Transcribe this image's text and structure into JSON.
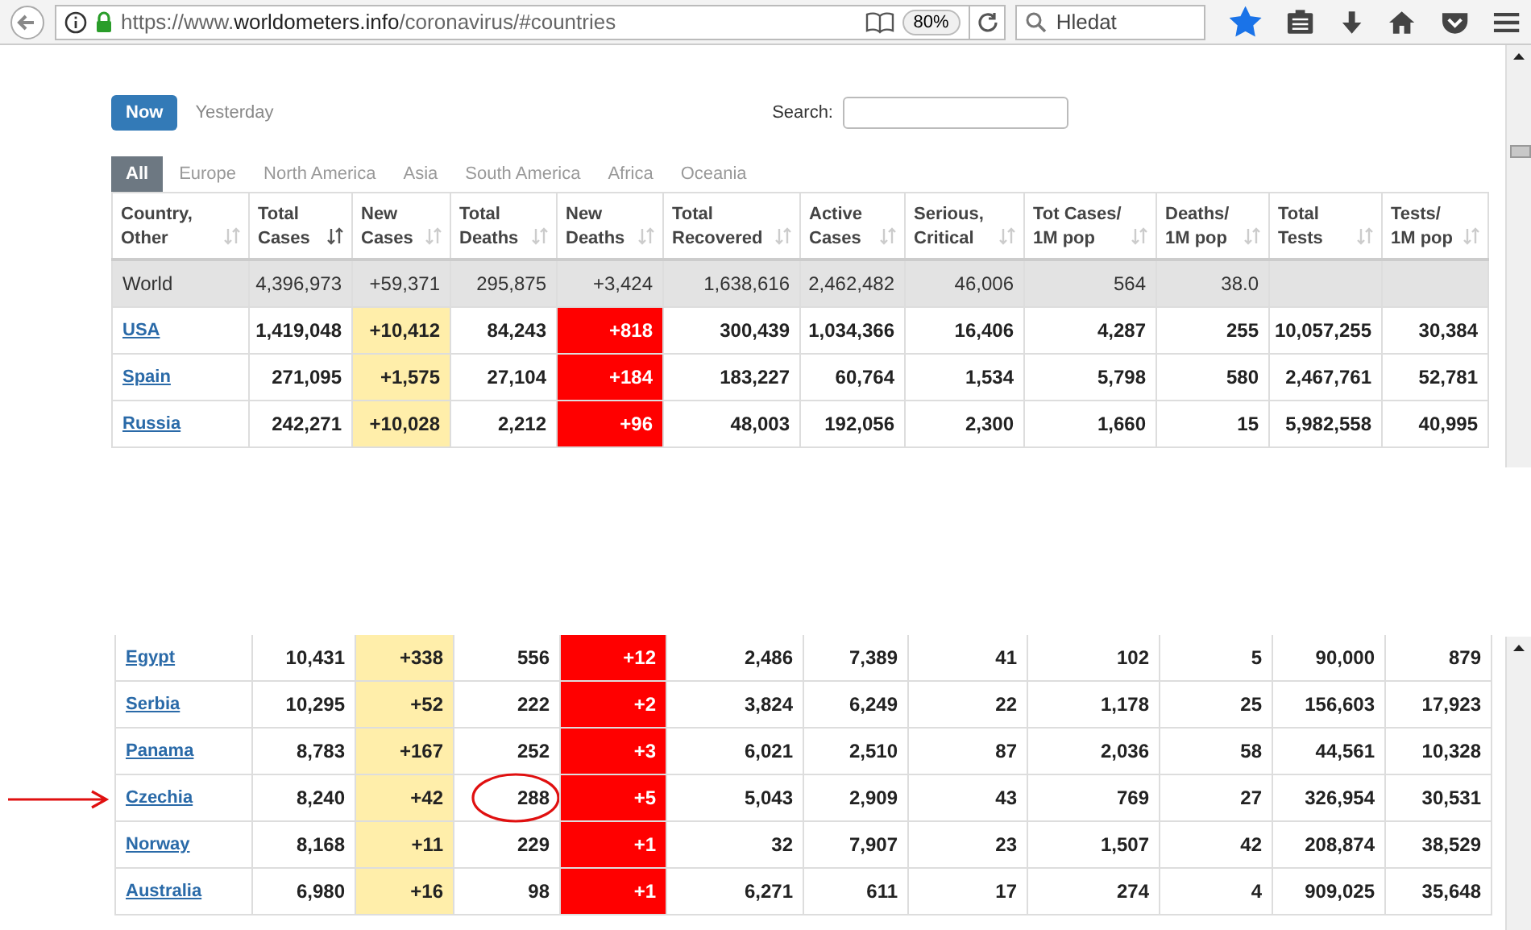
{
  "browser": {
    "url": {
      "scheme": "https://www.",
      "host": "worldometers.info",
      "path": "/coronavirus/#countries"
    },
    "zoom": "80%",
    "search": {
      "placeholder": "Hledat"
    },
    "bookmarked": true
  },
  "view_buttons": [
    {
      "label": "Now",
      "selected": true
    },
    {
      "label": "Yesterday",
      "selected": false
    }
  ],
  "search": {
    "label": "Search:"
  },
  "region_tabs": [
    {
      "label": "All",
      "selected": true
    },
    {
      "label": "Europe",
      "selected": false
    },
    {
      "label": "North America",
      "selected": false
    },
    {
      "label": "Asia",
      "selected": false
    },
    {
      "label": "South America",
      "selected": false
    },
    {
      "label": "Africa",
      "selected": false
    },
    {
      "label": "Oceania",
      "selected": false
    }
  ],
  "columns": [
    {
      "lines": [
        "Country,",
        "Other"
      ],
      "kind": "name",
      "sorted": false
    },
    {
      "lines": [
        "Total",
        "Cases"
      ],
      "kind": "number",
      "sorted": true
    },
    {
      "lines": [
        "New",
        "Cases"
      ],
      "kind": "new_cases",
      "sorted": false
    },
    {
      "lines": [
        "Total",
        "Deaths"
      ],
      "kind": "number",
      "sorted": false
    },
    {
      "lines": [
        "New",
        "Deaths"
      ],
      "kind": "new_deaths",
      "sorted": false
    },
    {
      "lines": [
        "Total",
        "Recovered"
      ],
      "kind": "number",
      "sorted": false
    },
    {
      "lines": [
        "Active",
        "Cases"
      ],
      "kind": "number",
      "sorted": false
    },
    {
      "lines": [
        "Serious,",
        "Critical"
      ],
      "kind": "number",
      "sorted": false
    },
    {
      "lines": [
        "Tot Cases/",
        "1M pop"
      ],
      "kind": "number",
      "sorted": false
    },
    {
      "lines": [
        "Deaths/",
        "1M pop"
      ],
      "kind": "number",
      "sorted": false
    },
    {
      "lines": [
        "Total",
        "Tests"
      ],
      "kind": "number",
      "sorted": false
    },
    {
      "lines": [
        "Tests/",
        "1M pop"
      ],
      "kind": "number",
      "sorted": false
    }
  ],
  "top_rows": [
    {
      "kind": "total",
      "country": "World",
      "total_cases": "4,396,973",
      "new_cases": "+59,371",
      "total_deaths": "295,875",
      "new_deaths": "+3,424",
      "total_recovered": "1,638,616",
      "active_cases": "2,462,482",
      "serious_critical": "46,006",
      "tot_cases_per_1m": "564",
      "deaths_per_1m": "38.0"
    },
    {
      "kind": "country",
      "country": "USA",
      "total_cases": "1,419,048",
      "new_cases": "+10,412",
      "total_deaths": "84,243",
      "new_deaths": "+818",
      "total_recovered": "300,439",
      "active_cases": "1,034,366",
      "serious_critical": "16,406",
      "tot_cases_per_1m": "4,287",
      "deaths_per_1m": "255",
      "total_tests": "10,057,255",
      "tests_per_1m": "30,384"
    },
    {
      "kind": "country",
      "country": "Spain",
      "total_cases": "271,095",
      "new_cases": "+1,575",
      "total_deaths": "27,104",
      "new_deaths": "+184",
      "total_recovered": "183,227",
      "active_cases": "60,764",
      "serious_critical": "1,534",
      "tot_cases_per_1m": "5,798",
      "deaths_per_1m": "580",
      "total_tests": "2,467,761",
      "tests_per_1m": "52,781"
    },
    {
      "kind": "country",
      "country": "Russia",
      "total_cases": "242,271",
      "new_cases": "+10,028",
      "total_deaths": "2,212",
      "new_deaths": "+96",
      "total_recovered": "48,003",
      "active_cases": "192,056",
      "serious_critical": "2,300",
      "tot_cases_per_1m": "1,660",
      "deaths_per_1m": "15",
      "total_tests": "5,982,558",
      "tests_per_1m": "40,995"
    }
  ],
  "bottom_rows": [
    {
      "kind": "country",
      "country": "Egypt",
      "total_cases": "10,431",
      "new_cases": "+338",
      "total_deaths": "556",
      "new_deaths": "+12",
      "total_recovered": "2,486",
      "active_cases": "7,389",
      "serious_critical": "41",
      "tot_cases_per_1m": "102",
      "deaths_per_1m": "5",
      "total_tests": "90,000",
      "tests_per_1m": "879"
    },
    {
      "kind": "country",
      "country": "Serbia",
      "total_cases": "10,295",
      "new_cases": "+52",
      "total_deaths": "222",
      "new_deaths": "+2",
      "total_recovered": "3,824",
      "active_cases": "6,249",
      "serious_critical": "22",
      "tot_cases_per_1m": "1,178",
      "deaths_per_1m": "25",
      "total_tests": "156,603",
      "tests_per_1m": "17,923"
    },
    {
      "kind": "country",
      "country": "Panama",
      "total_cases": "8,783",
      "new_cases": "+167",
      "total_deaths": "252",
      "new_deaths": "+3",
      "total_recovered": "6,021",
      "active_cases": "2,510",
      "serious_critical": "87",
      "tot_cases_per_1m": "2,036",
      "deaths_per_1m": "58",
      "total_tests": "44,561",
      "tests_per_1m": "10,328"
    },
    {
      "kind": "country",
      "arrow": true,
      "total_deaths_circled": true,
      "country": "Czechia",
      "total_cases": "8,240",
      "new_cases": "+42",
      "total_deaths": "288",
      "new_deaths": "+5",
      "total_recovered": "5,043",
      "active_cases": "2,909",
      "serious_critical": "43",
      "tot_cases_per_1m": "769",
      "deaths_per_1m": "27",
      "total_tests": "326,954",
      "tests_per_1m": "30,531"
    },
    {
      "kind": "country",
      "country": "Norway",
      "total_cases": "8,168",
      "new_cases": "+11",
      "total_deaths": "229",
      "new_deaths": "+1",
      "total_recovered": "32",
      "active_cases": "7,907",
      "serious_critical": "23",
      "tot_cases_per_1m": "1,507",
      "deaths_per_1m": "42",
      "total_tests": "208,874",
      "tests_per_1m": "38,529"
    },
    {
      "kind": "country",
      "country": "Australia",
      "total_cases": "6,980",
      "new_cases": "+16",
      "total_deaths": "98",
      "new_deaths": "+1",
      "total_recovered": "6,271",
      "active_cases": "611",
      "serious_critical": "17",
      "tot_cases_per_1m": "274",
      "deaths_per_1m": "4",
      "total_tests": "909,025",
      "tests_per_1m": "35,648"
    }
  ]
}
